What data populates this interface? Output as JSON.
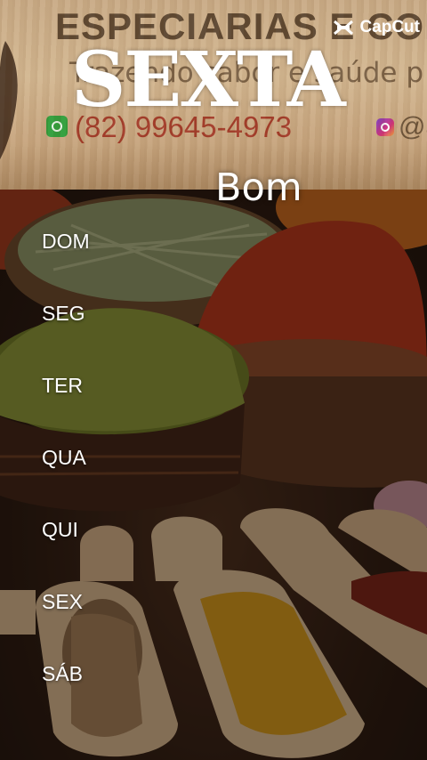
{
  "banner": {
    "title": "ESPECIARIAS E CON",
    "slogan": "Trazendo sabor e saúde p",
    "phone": "(82) 99645-4973",
    "instagram": "@a"
  },
  "watermark": {
    "brand": "CapCut",
    "icon": "capcut-logo-icon"
  },
  "overlay": {
    "day_title": "SEXTA",
    "greeting": "Bom"
  },
  "days": [
    "DOM",
    "SEG",
    "TER",
    "QUA",
    "QUI",
    "SEX",
    "SÁB"
  ],
  "colors": {
    "text": "#ffffff",
    "wood": "#c9ab86",
    "phone": "#a33a28",
    "whatsapp": "#2f9e3a"
  }
}
